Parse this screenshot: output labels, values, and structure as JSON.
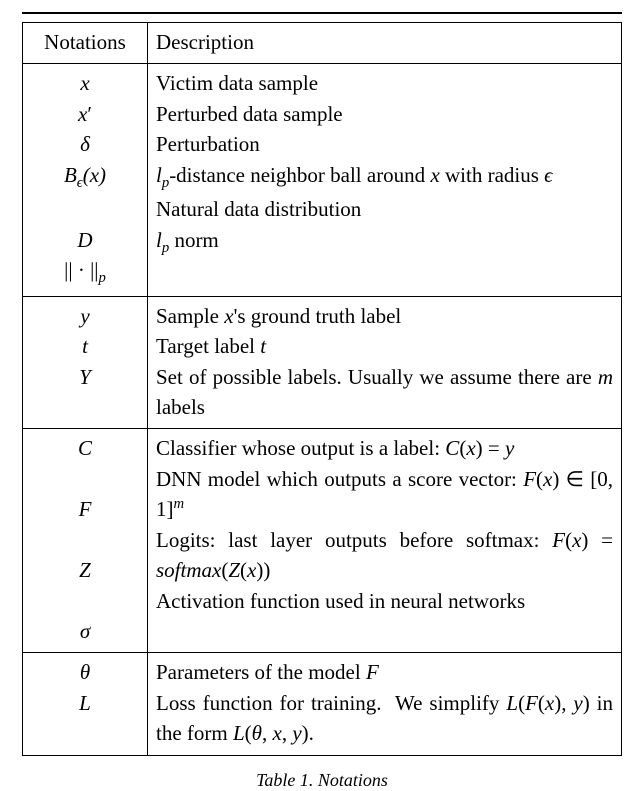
{
  "chart_data": {
    "type": "table",
    "title": "Table 1. Notations",
    "columns": [
      "Notations",
      "Description"
    ],
    "groups": [
      {
        "rows": [
          {
            "notation": "x",
            "description": "Victim data sample"
          },
          {
            "notation": "x′",
            "description": "Perturbed data sample"
          },
          {
            "notation": "δ",
            "description": "Perturbation"
          },
          {
            "notation": "B_ε(x)",
            "description": "l_p-distance neighbor ball around x with radius ε"
          },
          {
            "notation": "𝒟",
            "description": "Natural data distribution"
          },
          {
            "notation": "|| · ||_p",
            "description": "l_p norm"
          }
        ]
      },
      {
        "rows": [
          {
            "notation": "y",
            "description": "Sample x's ground truth label"
          },
          {
            "notation": "t",
            "description": "Target label t"
          },
          {
            "notation": "𝒴",
            "description": "Set of possible labels. Usually we assume there are m labels"
          }
        ]
      },
      {
        "rows": [
          {
            "notation": "C",
            "description": "Classifier whose output is a label: C(x) = y"
          },
          {
            "notation": "F",
            "description": "DNN model which outputs a score vector: F(x) ∈ [0, 1]^m"
          },
          {
            "notation": "Z",
            "description": "Logits: last layer outputs before softmax: F(x) = softmax(Z(x))"
          },
          {
            "notation": "σ",
            "description": "Activation function used in neural networks"
          }
        ]
      },
      {
        "rows": [
          {
            "notation": "θ",
            "description": "Parameters of the model F"
          },
          {
            "notation": "ℒ",
            "description": "Loss function for training.  We simplify ℒ(F(x), y) in the form ℒ(θ, x, y)."
          }
        ]
      }
    ]
  },
  "header": {
    "col_notations": "Notations",
    "col_description": "Description"
  },
  "g1": {
    "n1": "x",
    "d1": "Victim data sample",
    "n2_html": "<span class='mi'>x</span><span class='rm' style='font-style:normal'>′</span>",
    "d2": "Perturbed data sample",
    "n3": "δ",
    "d3": "Perturbation",
    "n4_html": "<span class='mi'>B</span><span class='sub'>ϵ</span>(<span class='mi'>x</span>)",
    "d4_html": "<span class='mi'>l<span class='sub'>p</span></span>-distance neighbor ball around <span class='mi'>x</span> with radius <span class='mi'>ϵ</span>",
    "n5_html": "<span class='cal'>D</span>",
    "d5": "Natural data distribution",
    "n6_html": "<span class='rm'>|| · ||</span><span class='sub'>p</span>",
    "d6_html": "<span class='mi'>l<span class='sub'>p</span></span> norm"
  },
  "g2": {
    "n1": "y",
    "d1_html": "Sample <span class='mi'>x</span>'s ground truth label",
    "n2": "t",
    "d2_html": "Target label <span class='mi'>t</span>",
    "n3_html": "<span class='cal'>Y</span>",
    "d3_html": "Set of possible labels. Usually we assume there are <span class='mi'>m</span> labels"
  },
  "g3": {
    "n1": "C",
    "d1_html": "Classifier whose output is a label: <span class='mi'>C</span>(<span class='mi'>x</span>) = <span class='mi'>y</span>",
    "n2": "F",
    "d2_html": "DNN model which outputs a score vector: <span class='mi'>F</span>(<span class='mi'>x</span>) ∈ [0, 1]<span class='sup'>m</span>",
    "n3": "Z",
    "d3_html": "Logits: last layer outputs before softmax: <span class='mi'>F</span>(<span class='mi'>x</span>) = <span class='mi'>softmax</span>(<span class='mi'>Z</span>(<span class='mi'>x</span>))",
    "n4": "σ",
    "d4": "Activation function used in neural networks"
  },
  "g4": {
    "n1": "θ",
    "d1_html": "Parameters of the model <span class='mi'>F</span>",
    "n2_html": "<span class='cal'>L</span>",
    "d2_html": "Loss function for training.&nbsp; We simplify <span class='cal'>L</span>(<span class='mi'>F</span>(<span class='mi'>x</span>), <span class='mi'>y</span>) in the form <span class='cal'>L</span>(<span class='mi'>θ</span>, <span class='mi'>x</span>, <span class='mi'>y</span>)."
  },
  "caption": "Table 1. Notations"
}
